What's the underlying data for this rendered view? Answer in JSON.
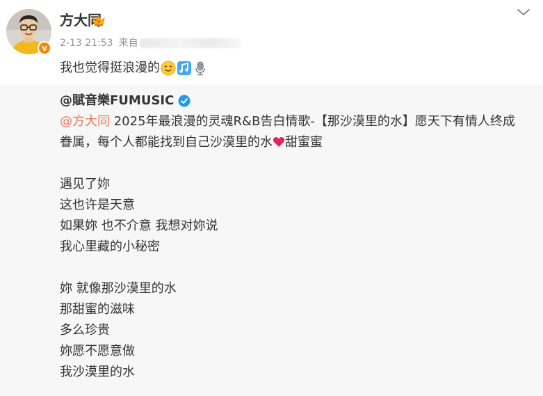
{
  "post": {
    "author": "方大同",
    "timestamp": "2-13 21:53",
    "source_prefix": "来自",
    "text": "我也觉得挺浪漫的",
    "emojis": [
      "smiling-face-icon",
      "music-note-icon",
      "microphone-icon"
    ]
  },
  "repost": {
    "author": "@賦音樂FUMUSIC",
    "mention": "@方大同",
    "text_part1": " 2025年最浪漫的灵魂R&B告白情歌-【那沙漠里的水】愿天下有情人终成眷属，每个人都能找到自己沙漠里的水",
    "text_part2": "甜蜜蜜",
    "stanzas": [
      [
        "遇见了妳",
        "这也许是天意",
        "如果妳  也不介意  我想对妳说",
        "我心里藏的小秘密"
      ],
      [
        "妳  就像那沙漠里的水",
        "那甜蜜的滋味",
        "多么珍贵",
        "妳愿不愿意做",
        "我沙漠里的水"
      ]
    ]
  },
  "colors": {
    "mention": "#eb7350",
    "badge": "#ff8200",
    "verified": "#1d9bf0",
    "heart": "#e0245e",
    "repost_bg": "#f7f7f7"
  }
}
